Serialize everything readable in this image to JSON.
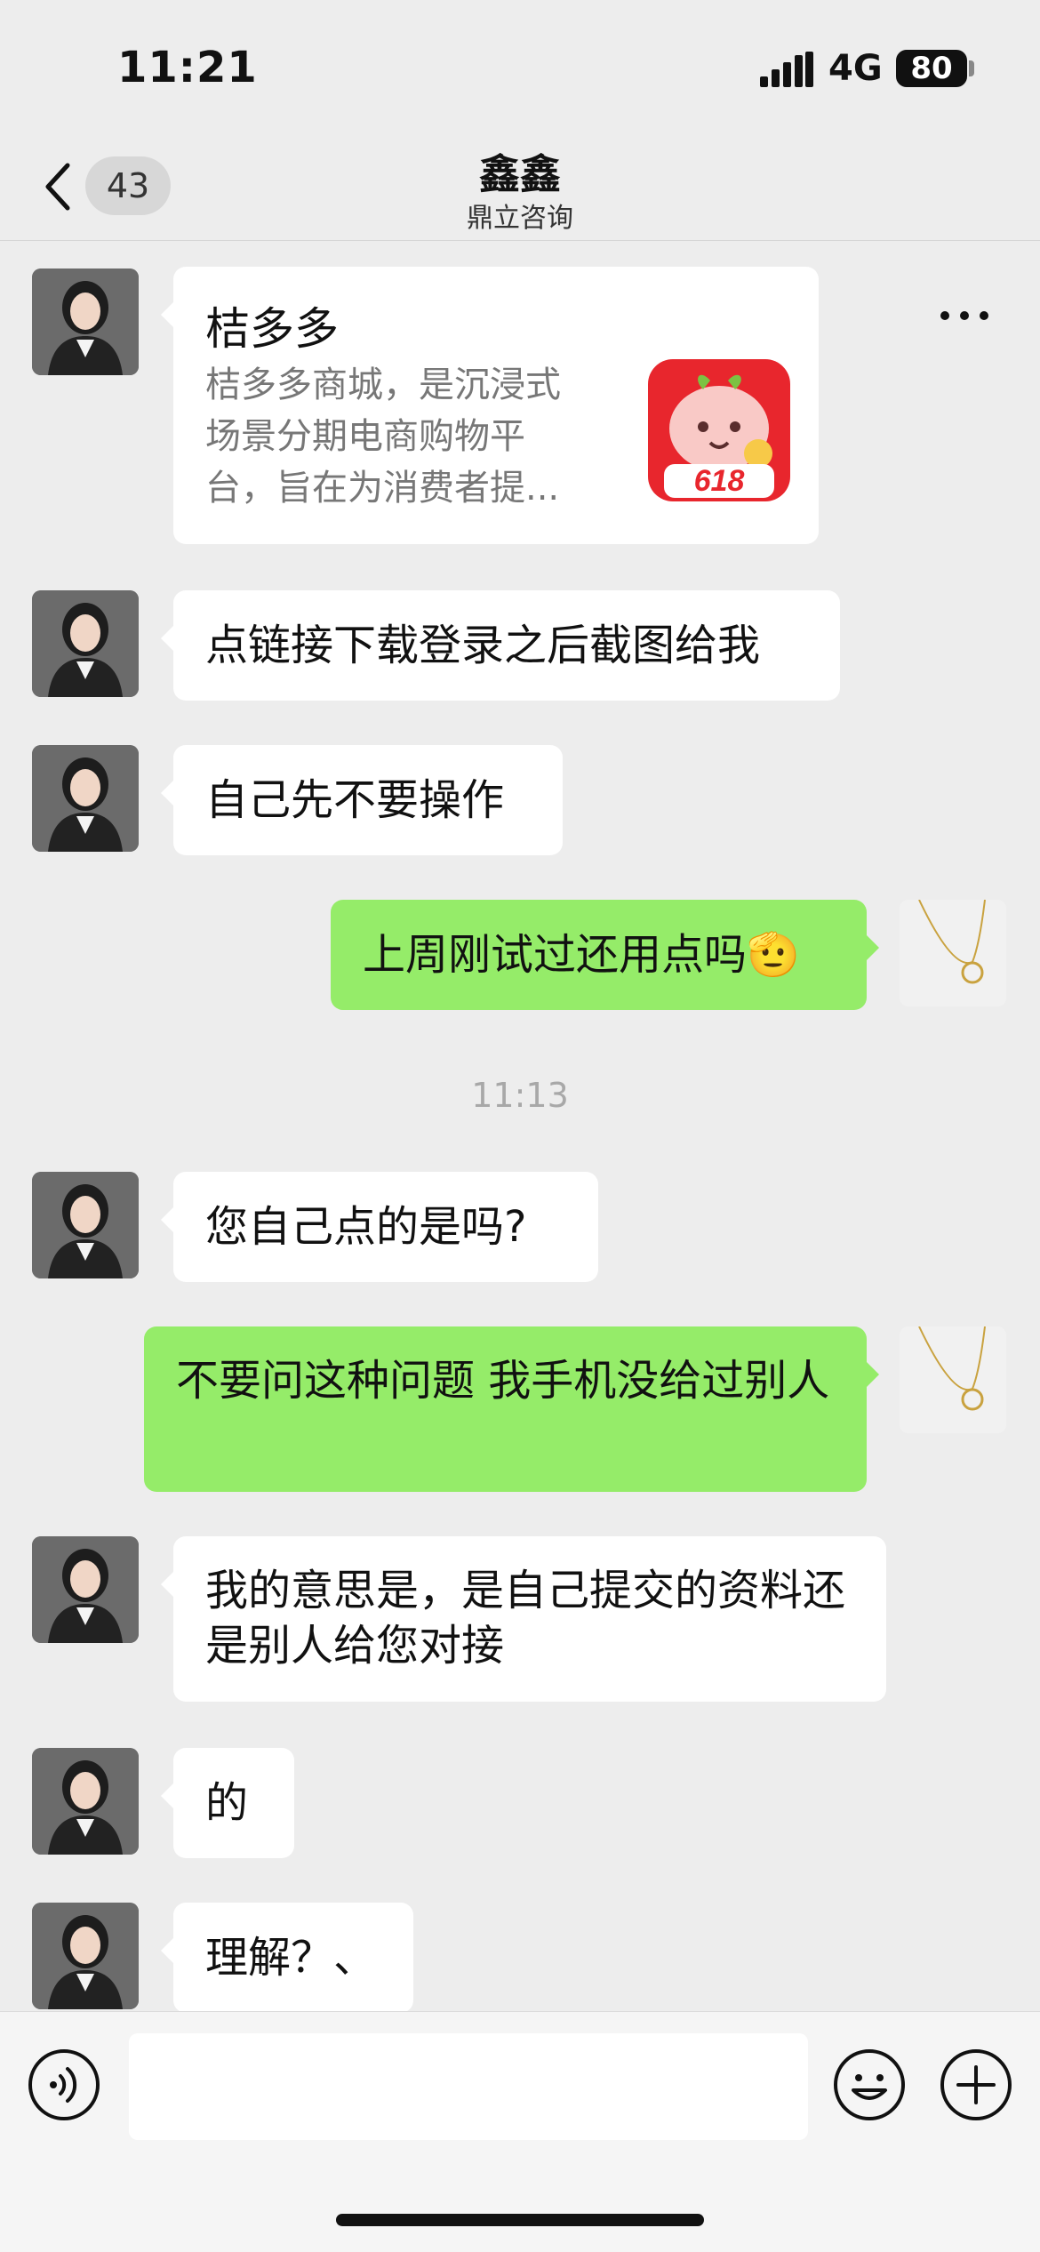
{
  "status_bar": {
    "time": "11:21",
    "network": "4G",
    "battery": "80"
  },
  "header": {
    "unread_count": "43",
    "title": "鑫鑫",
    "subtitle": "鼎立咨询"
  },
  "link_card": {
    "title": "桔多多",
    "description": "桔多多商城，是沉浸式场景分期电商购物平台，旨在为消费者提...",
    "icon_text": "618"
  },
  "messages": [
    {
      "side": "left",
      "text": "点链接下载登录之后截图给我"
    },
    {
      "side": "left",
      "text": "自己先不要操作"
    },
    {
      "side": "right",
      "text": "上周刚试过还用点吗🫡"
    },
    {
      "side": "left",
      "text": "您自己点的是吗?"
    },
    {
      "side": "right",
      "text": "不要问这种问题 我手机没给过别人"
    },
    {
      "side": "left",
      "text": "我的意思是，是自己提交的资料还是别人给您对接"
    },
    {
      "side": "left",
      "text": "的"
    },
    {
      "side": "left",
      "text": "理解？、"
    }
  ],
  "timestamp": "11:13",
  "colors": {
    "background": "#ededed",
    "sent_bubble": "#95ec69",
    "received_bubble": "#ffffff"
  }
}
